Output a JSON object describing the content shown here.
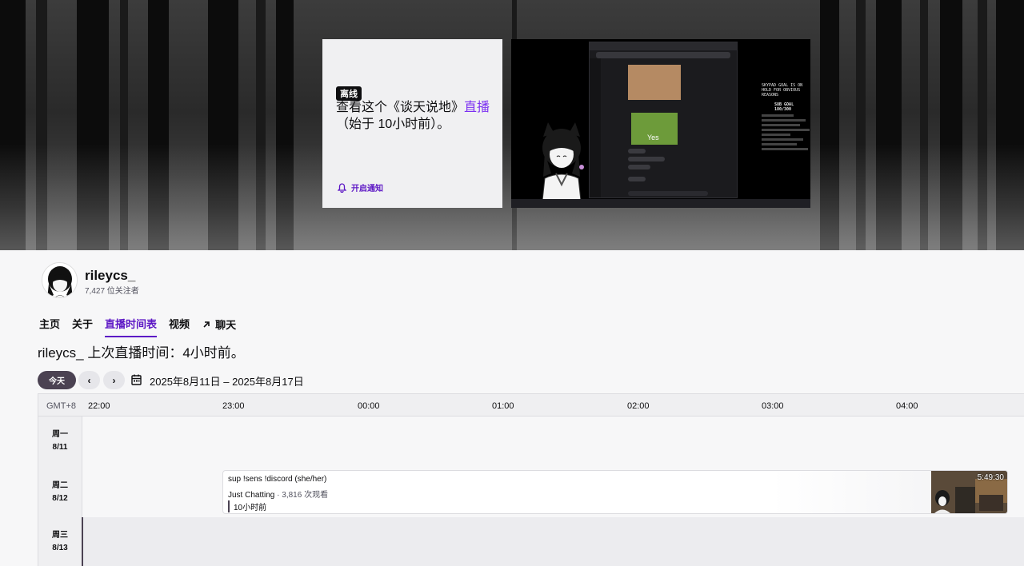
{
  "banner": {
    "offline_badge": "离线",
    "offline_text_prefix": "查看这个《谈天说地》",
    "offline_text_link": "直播",
    "offline_text_suffix": "（始于 10小时前）。",
    "notify_label": "开启通知",
    "preview": {
      "goal_hold": "SKYPAD GOAL IS ON HOLD FOR OBVIOUS REASONS",
      "sub_goal": "SUB GOAL 180/300",
      "yes_label": "Yes"
    }
  },
  "channel": {
    "name": "rileycs_",
    "followers": "7,427 位关注者"
  },
  "tabs": [
    {
      "label": "主页"
    },
    {
      "label": "关于"
    },
    {
      "label": "直播时间表"
    },
    {
      "label": "视频"
    },
    {
      "label": "聊天"
    }
  ],
  "last_live": "rileycs_ 上次直播时间：4小时前。",
  "controls": {
    "today_label": "今天",
    "prev_icon": "‹",
    "next_icon": "›",
    "date_range": "2025年8月11日 – 2025年8月17日"
  },
  "schedule": {
    "timezone": "GMT+8",
    "hours": [
      "22:00",
      "23:00",
      "00:00",
      "01:00",
      "02:00",
      "03:00",
      "04:00"
    ],
    "days": [
      {
        "name": "周一",
        "date": "8/11"
      },
      {
        "name": "周二",
        "date": "8/12"
      },
      {
        "name": "周三",
        "date": "8/13"
      }
    ],
    "event": {
      "title": "sup !sens !discord (she/her)",
      "category": "Just Chatting",
      "views": " · 3,816 次观看",
      "time_ago": "10小时前",
      "duration": "5:49:30"
    }
  },
  "colors": {
    "accent": "#5c16c5",
    "today_button": "#4b4252"
  }
}
